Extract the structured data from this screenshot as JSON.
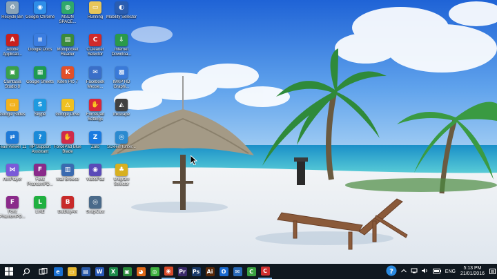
{
  "desktop": {
    "icons": [
      {
        "label": "Recycle Bin",
        "icon": "recycle-bin-icon",
        "color": "#8aa4b8",
        "glyph": "♻"
      },
      {
        "label": "Google Chrome",
        "icon": "chrome-icon",
        "color": "#2f8ee8",
        "glyph": "◉"
      },
      {
        "label": "MSDN SPACE...",
        "icon": "globe-icon",
        "color": "#2fa86a",
        "glyph": "◍"
      },
      {
        "label": "Running",
        "icon": "folder-icon",
        "color": "#e7c65a",
        "glyph": "▭"
      },
      {
        "label": "Mobility Selector",
        "icon": "mobility-icon",
        "color": "#2a5db0",
        "glyph": "◐"
      },
      {
        "label": "Adobe Applicati...",
        "icon": "adobe-icon",
        "color": "#c8201e",
        "glyph": "A"
      },
      {
        "label": "Google Docs",
        "icon": "docs-icon",
        "color": "#3b7de0",
        "glyph": "≡"
      },
      {
        "label": "Mobipocket Reader",
        "icon": "reader-icon",
        "color": "#3a8a3a",
        "glyph": "▤"
      },
      {
        "label": "CCleaner Selector",
        "icon": "ccleaner-icon",
        "color": "#d02a2a",
        "glyph": "C"
      },
      {
        "label": "Internet Downloa...",
        "icon": "download-icon",
        "color": "#2a9a4a",
        "glyph": "⇩"
      },
      {
        "label": "Camtasia Studio 8",
        "icon": "camtasia-icon",
        "color": "#3aa04a",
        "glyph": "▣"
      },
      {
        "label": "Google Sheets",
        "icon": "sheets-icon",
        "color": "#1e9a50",
        "glyph": "▦"
      },
      {
        "label": "Kiten Pro 7",
        "icon": "kiten-icon",
        "color": "#e2502a",
        "glyph": "K"
      },
      {
        "label": "Facebook Messe...",
        "icon": "messenger-icon",
        "color": "#3a6fc8",
        "glyph": "✉"
      },
      {
        "label": "IMKP HD Graphi...",
        "icon": "graphics-icon",
        "color": "#3a7ad8",
        "glyph": "▩"
      },
      {
        "label": "Google Slides",
        "icon": "slides-icon",
        "color": "#f2b21e",
        "glyph": "▭"
      },
      {
        "label": "Skype",
        "icon": "skype-icon",
        "color": "#1e9ae0",
        "glyph": "S"
      },
      {
        "label": "Google Drive",
        "icon": "drive-icon",
        "color": "#f0c020",
        "glyph": "△"
      },
      {
        "label": "ForcePad Settings",
        "icon": "forcepad-icon",
        "color": "#d8283a",
        "glyph": "✋"
      },
      {
        "label": "Inkscape",
        "icon": "inkscape-icon",
        "color": "#404040",
        "glyph": "◭"
      },
      {
        "label": "TeamViewer 11",
        "icon": "teamviewer-icon",
        "color": "#1e7ad8",
        "glyph": "⇄"
      },
      {
        "label": "HP Support Assistant",
        "icon": "hp-support-icon",
        "color": "#1a8ad8",
        "glyph": "?"
      },
      {
        "label": "ForcePad Blue Blade",
        "icon": "forcepad-blue-icon",
        "color": "#d02a4a",
        "glyph": "✋"
      },
      {
        "label": "Zalo",
        "icon": "zalo-icon",
        "color": "#1a7ae0",
        "glyph": "Z"
      },
      {
        "label": "ScreenHunter...",
        "icon": "screenhunter-icon",
        "color": "#2a8ad0",
        "glyph": "◎"
      },
      {
        "label": "AimPlayer",
        "icon": "aimplayer-icon",
        "color": "#7a5ad8",
        "glyph": "⋈"
      },
      {
        "label": "Foxit PhantomPD...",
        "icon": "foxit-icon",
        "color": "#8a2a8a",
        "glyph": "F"
      },
      {
        "label": "Mail Browse",
        "icon": "mail-browse-icon",
        "color": "#3a6ab0",
        "glyph": "▥"
      },
      {
        "label": "VideoPad",
        "icon": "videopad-icon",
        "color": "#5a4ab8",
        "glyph": "◉"
      },
      {
        "label": "Unigram Selector",
        "icon": "unigram-icon",
        "color": "#d8b020",
        "glyph": "♣"
      },
      {
        "label": "Foxit PhantomPD...",
        "icon": "foxit-icon-2",
        "color": "#8a2a8a",
        "glyph": "F"
      },
      {
        "label": "LINE",
        "icon": "line-icon",
        "color": "#20b040",
        "glyph": "L"
      },
      {
        "label": "BaiBaiyAK",
        "icon": "baibai-icon",
        "color": "#c82a2a",
        "glyph": "B"
      },
      {
        "label": "SnapCast",
        "icon": "snapcast-icon",
        "color": "#4a6a8a",
        "glyph": "◎"
      }
    ]
  },
  "taskbar": {
    "start": {
      "icon": "windows-start-icon"
    },
    "search": {
      "icon": "search-icon"
    },
    "taskview": {
      "icon": "task-view-icon"
    },
    "apps": [
      {
        "icon": "edge-icon",
        "color": "#1a6fd0",
        "glyph": "e",
        "running": false
      },
      {
        "icon": "file-explorer-icon",
        "color": "#e8b830",
        "glyph": "▭",
        "running": false
      },
      {
        "icon": "store-icon",
        "color": "#2a5aa8",
        "glyph": "▤",
        "running": false
      },
      {
        "icon": "word-icon",
        "color": "#2a5ab8",
        "glyph": "W",
        "running": false
      },
      {
        "icon": "excel-icon",
        "color": "#1e8a4a",
        "glyph": "X",
        "running": false
      },
      {
        "icon": "camtasia-taskbar-icon",
        "color": "#2a8a3a",
        "glyph": "▣",
        "running": false
      },
      {
        "icon": "firefox-icon",
        "color": "#e06a1a",
        "glyph": "◕",
        "running": false
      },
      {
        "icon": "360-icon",
        "color": "#40b040",
        "glyph": "◎",
        "running": false
      },
      {
        "icon": "chrome-taskbar-icon",
        "color": "#d84a2a",
        "glyph": "◉",
        "running": true
      },
      {
        "icon": "premiere-icon",
        "color": "#3a2a6a",
        "glyph": "Pr",
        "running": false
      },
      {
        "icon": "photoshop-icon",
        "color": "#1a3a6a",
        "glyph": "Ps",
        "running": false
      },
      {
        "icon": "illustrator-icon",
        "color": "#5a2a0a",
        "glyph": "Ai",
        "running": false
      },
      {
        "icon": "outlook-icon",
        "color": "#1a6ad0",
        "glyph": "O",
        "running": false
      },
      {
        "icon": "mail-icon",
        "color": "#2a6ab8",
        "glyph": "✉",
        "running": false
      },
      {
        "icon": "camtasia-recorder-icon",
        "color": "#3aa040",
        "glyph": "C",
        "running": false
      },
      {
        "icon": "ccleaner-taskbar-icon",
        "color": "#d03030",
        "glyph": "C",
        "running": true
      }
    ],
    "tray": {
      "help_icon": "help-icon",
      "chevron_icon": "chevron-up-icon",
      "language": "ENG",
      "time": "5:13 PM",
      "date": "21/01/2016"
    }
  }
}
